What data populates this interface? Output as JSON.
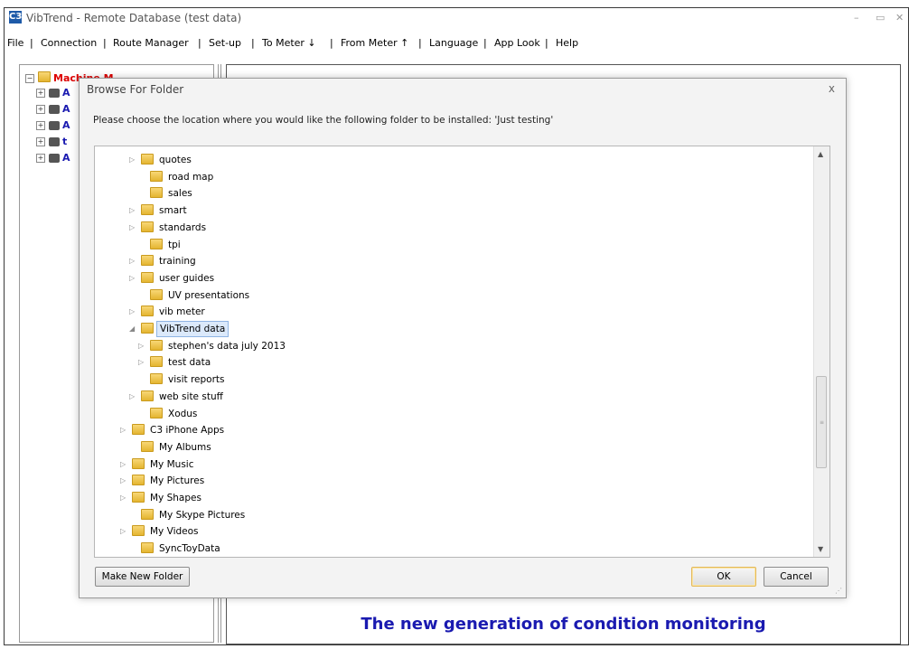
{
  "window": {
    "title": "VibTrend - Remote Database (test data)",
    "icon_text": "C3",
    "minimize": "–",
    "restore": "▭",
    "close": "✕"
  },
  "menu": [
    "File",
    "|",
    "Connection",
    "|",
    "Route Manager",
    "|",
    "Set-up",
    "|",
    "To Meter ↓",
    "|",
    "From Meter ↑",
    "|",
    "Language",
    "|",
    "App Look",
    "|",
    "Help"
  ],
  "left_tree": {
    "root_label": "Machine M",
    "children": [
      "A",
      "A",
      "A",
      "t",
      "A"
    ]
  },
  "footer_text": "The new generation of condition monitoring",
  "dialog": {
    "title": "Browse For Folder",
    "close": "x",
    "message": "Please choose the location where you would like the following folder to be installed: 'Just testing'",
    "folders": [
      {
        "label": "quotes",
        "expandable": true
      },
      {
        "label": "road map",
        "expandable": false
      },
      {
        "label": "sales",
        "expandable": false
      },
      {
        "label": "smart",
        "expandable": true
      },
      {
        "label": "standards",
        "expandable": true
      },
      {
        "label": "tpi",
        "expandable": false
      },
      {
        "label": "training",
        "expandable": true
      },
      {
        "label": "user guides",
        "expandable": true
      },
      {
        "label": "UV presentations",
        "expandable": false
      },
      {
        "label": "vib meter",
        "expandable": true
      },
      {
        "label": "VibTrend data",
        "expandable": true,
        "expanded": true,
        "selected": true
      },
      {
        "label": "stephen's data july 2013",
        "expandable": true
      },
      {
        "label": "test data",
        "expandable": true
      },
      {
        "label": "visit reports",
        "expandable": false
      },
      {
        "label": "web site stuff",
        "expandable": true
      },
      {
        "label": "Xodus",
        "expandable": false
      },
      {
        "label": "C3 iPhone Apps",
        "expandable": true
      },
      {
        "label": "My Albums",
        "expandable": false
      },
      {
        "label": "My Music",
        "expandable": true
      },
      {
        "label": "My Pictures",
        "expandable": true
      },
      {
        "label": "My Shapes",
        "expandable": true
      },
      {
        "label": "My Skype Pictures",
        "expandable": false
      },
      {
        "label": "My Videos",
        "expandable": true
      },
      {
        "label": "SyncToyData",
        "expandable": false
      }
    ],
    "buttons": {
      "make_new_folder": "Make New Folder",
      "ok": "OK",
      "cancel": "Cancel"
    }
  }
}
